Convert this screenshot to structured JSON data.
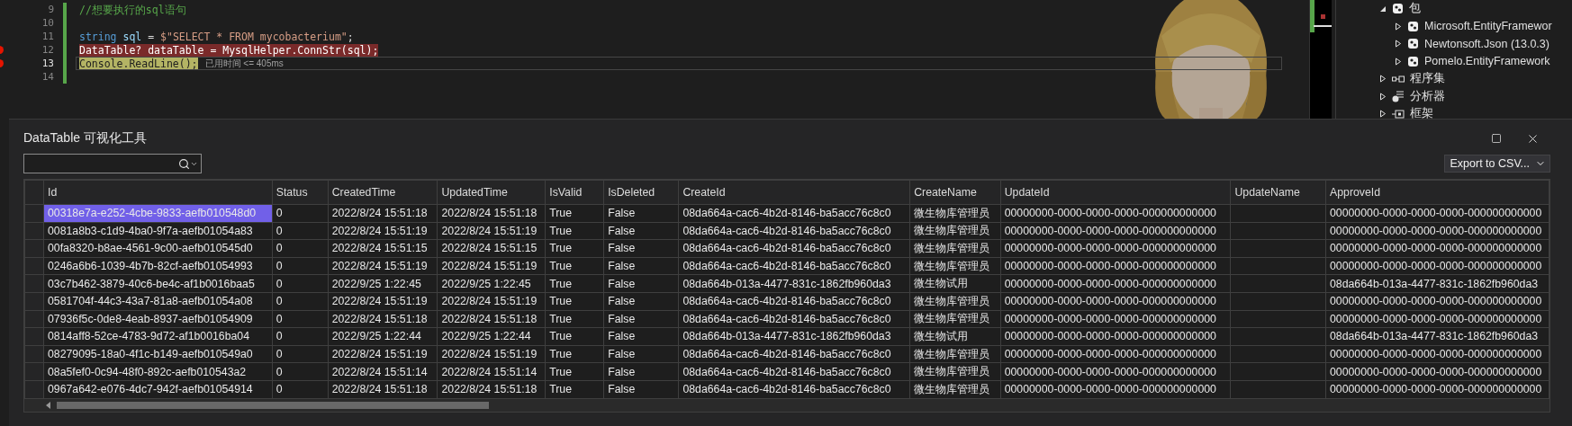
{
  "editor": {
    "lines": [
      {
        "number": "9",
        "kind": "plain",
        "breakpoint": false,
        "current": false,
        "tokens": [
          {
            "kind": "comment",
            "text": "//想要执行的sql语句"
          }
        ]
      },
      {
        "number": "10",
        "breakpoint": false,
        "current": false
      },
      {
        "number": "11",
        "kind": "plain",
        "breakpoint": false,
        "current": false,
        "tokens": [
          {
            "kind": "keyword",
            "text": "string "
          },
          {
            "kind": "variable",
            "text": "sql"
          },
          {
            "kind": "plain",
            "text": " = "
          },
          {
            "kind": "string",
            "text": "$\"SELECT * FROM mycobacterium\""
          },
          {
            "kind": "plain",
            "text": ";"
          }
        ]
      },
      {
        "number": "12",
        "kind": "error",
        "breakpoint": true,
        "current": false,
        "tokens": [
          {
            "kind": "plain",
            "text": "DataTable? dataTable = MysqlHelper.ConnStr(sql);"
          }
        ]
      },
      {
        "number": "13",
        "kind": "statement",
        "breakpoint": true,
        "current": true,
        "hint": "已用时间 <= 405ms",
        "tokens": [
          {
            "kind": "plain",
            "text": "Console.ReadLine();"
          }
        ]
      },
      {
        "number": "14",
        "breakpoint": false,
        "current": false
      }
    ]
  },
  "solution_tree": [
    {
      "label": "包",
      "kind": "package",
      "expanded": true,
      "children": [
        {
          "label": "Microsoft.EntityFramewor",
          "kind": "package",
          "expanded": false
        },
        {
          "label": "Newtonsoft.Json (13.0.3)",
          "kind": "package",
          "expanded": false
        },
        {
          "label": "Pomelo.EntityFramework",
          "kind": "package",
          "expanded": false
        }
      ]
    },
    {
      "label": "程序集",
      "kind": "assembly",
      "expanded": false
    },
    {
      "label": "分析器",
      "kind": "analyzer",
      "expanded": false
    },
    {
      "label": "框架",
      "kind": "framework",
      "expanded": false
    }
  ],
  "dialog": {
    "title": "DataTable 可视化工具",
    "export_button": "Export to CSV...",
    "table": {
      "columns": [
        "Id",
        "Status",
        "CreatedTime",
        "UpdatedTime",
        "IsValid",
        "IsDeleted",
        "CreateId",
        "CreateName",
        "UpdateId",
        "UpdateName",
        "ApproveId"
      ],
      "rows": [
        {
          "selected": true,
          "cells": [
            "00318e7a-e252-4cbe-9833-aefb010548d0",
            "0",
            "2022/8/24 15:51:18",
            "2022/8/24 15:51:18",
            "True",
            "False",
            "08da664a-cac6-4b2d-8146-ba5acc76c8c0",
            "微生物库管理员",
            "00000000-0000-0000-0000-000000000000",
            null,
            "00000000-0000-0000-0000-000000000000"
          ]
        },
        {
          "selected": false,
          "cells": [
            "0081a8b3-c1d9-4ba0-9f7a-aefb01054a83",
            "0",
            "2022/8/24 15:51:19",
            "2022/8/24 15:51:19",
            "True",
            "False",
            "08da664a-cac6-4b2d-8146-ba5acc76c8c0",
            "微生物库管理员",
            "00000000-0000-0000-0000-000000000000",
            null,
            "00000000-0000-0000-0000-000000000000"
          ]
        },
        {
          "selected": false,
          "cells": [
            "00fa8320-b8ae-4561-9c00-aefb010545d0",
            "0",
            "2022/8/24 15:51:15",
            "2022/8/24 15:51:15",
            "True",
            "False",
            "08da664a-cac6-4b2d-8146-ba5acc76c8c0",
            "微生物库管理员",
            "00000000-0000-0000-0000-000000000000",
            null,
            "00000000-0000-0000-0000-000000000000"
          ]
        },
        {
          "selected": false,
          "cells": [
            "0246a6b6-1039-4b7b-82cf-aefb01054993",
            "0",
            "2022/8/24 15:51:19",
            "2022/8/24 15:51:19",
            "True",
            "False",
            "08da664a-cac6-4b2d-8146-ba5acc76c8c0",
            "微生物库管理员",
            "00000000-0000-0000-0000-000000000000",
            null,
            "00000000-0000-0000-0000-000000000000"
          ]
        },
        {
          "selected": false,
          "cells": [
            "03c7b462-3879-40c6-be4c-af1b0016baa5",
            "0",
            "2022/9/25 1:22:45",
            "2022/9/25 1:22:45",
            "True",
            "False",
            "08da664b-013a-4477-831c-1862fb960da3",
            "微生物试用",
            "00000000-0000-0000-0000-000000000000",
            null,
            "08da664b-013a-4477-831c-1862fb960da3"
          ]
        },
        {
          "selected": false,
          "cells": [
            "0581704f-44c3-43a7-81a8-aefb01054a08",
            "0",
            "2022/8/24 15:51:19",
            "2022/8/24 15:51:19",
            "True",
            "False",
            "08da664a-cac6-4b2d-8146-ba5acc76c8c0",
            "微生物库管理员",
            "00000000-0000-0000-0000-000000000000",
            null,
            "00000000-0000-0000-0000-000000000000"
          ]
        },
        {
          "selected": false,
          "cells": [
            "07936f5c-0de8-4eab-8937-aefb01054909",
            "0",
            "2022/8/24 15:51:18",
            "2022/8/24 15:51:18",
            "True",
            "False",
            "08da664a-cac6-4b2d-8146-ba5acc76c8c0",
            "微生物库管理员",
            "00000000-0000-0000-0000-000000000000",
            null,
            "00000000-0000-0000-0000-000000000000"
          ]
        },
        {
          "selected": false,
          "cells": [
            "0814aff8-52ce-4783-9d72-af1b0016ba04",
            "0",
            "2022/9/25 1:22:44",
            "2022/9/25 1:22:44",
            "True",
            "False",
            "08da664b-013a-4477-831c-1862fb960da3",
            "微生物试用",
            "00000000-0000-0000-0000-000000000000",
            null,
            "08da664b-013a-4477-831c-1862fb960da3"
          ]
        },
        {
          "selected": false,
          "cells": [
            "08279095-18a0-4f1c-b149-aefb010549a0",
            "0",
            "2022/8/24 15:51:19",
            "2022/8/24 15:51:19",
            "True",
            "False",
            "08da664a-cac6-4b2d-8146-ba5acc76c8c0",
            "微生物库管理员",
            "00000000-0000-0000-0000-000000000000",
            null,
            "00000000-0000-0000-0000-000000000000"
          ]
        },
        {
          "selected": false,
          "cells": [
            "08a5fef0-0c94-48f0-892c-aefb010543a2",
            "0",
            "2022/8/24 15:51:14",
            "2022/8/24 15:51:14",
            "True",
            "False",
            "08da664a-cac6-4b2d-8146-ba5acc76c8c0",
            "微生物库管理员",
            "00000000-0000-0000-0000-000000000000",
            null,
            "00000000-0000-0000-0000-000000000000"
          ]
        },
        {
          "selected": false,
          "cells": [
            "0967a642-e076-4dc7-942f-aefb01054914",
            "0",
            "2022/8/24 15:51:18",
            "2022/8/24 15:51:18",
            "True",
            "False",
            "08da664a-cac6-4b2d-8146-ba5acc76c8c0",
            "微生物库管理员",
            "00000000-0000-0000-0000-000000000000",
            null,
            "00000000-0000-0000-0000-000000000000"
          ]
        }
      ]
    }
  }
}
